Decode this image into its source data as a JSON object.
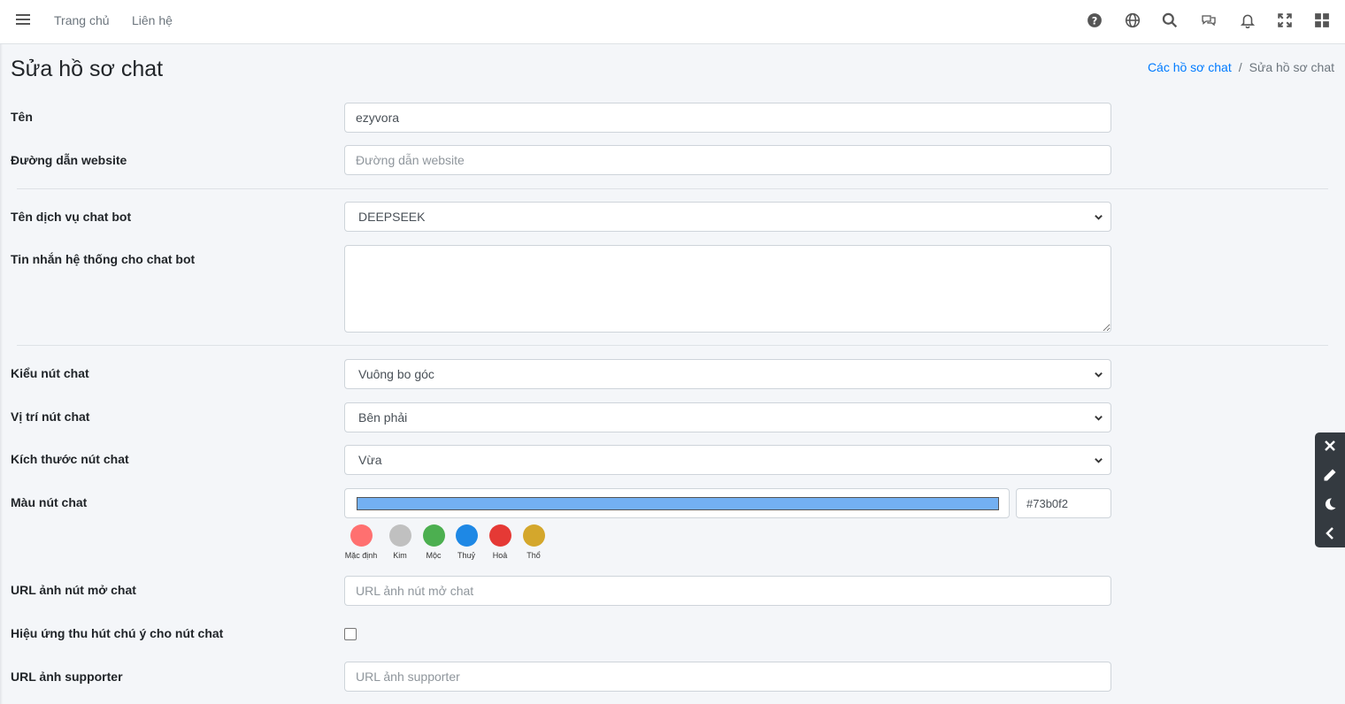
{
  "navbar": {
    "links": [
      "Trang chủ",
      "Liên hệ"
    ],
    "icons": [
      "help-icon",
      "globe-icon",
      "search-icon",
      "chat-icon",
      "bell-icon",
      "fullscreen-icon",
      "grid-icon"
    ]
  },
  "page": {
    "title": "Sửa hồ sơ chat",
    "breadcrumb": {
      "link": "Các hồ sơ chat",
      "separator": "/",
      "current": "Sửa hồ sơ chat"
    }
  },
  "form": {
    "name": {
      "label": "Tên",
      "value": "ezyvora"
    },
    "website": {
      "label": "Đường dẫn website",
      "placeholder": "Đường dẫn website",
      "value": ""
    },
    "chatbot_service": {
      "label": "Tên dịch vụ chat bot",
      "selected": "DEEPSEEK"
    },
    "system_message": {
      "label": "Tin nhắn hệ thống cho chat bot",
      "value": ""
    },
    "button_style": {
      "label": "Kiểu nút chat",
      "selected": "Vuông bo góc"
    },
    "button_position": {
      "label": "Vị trí nút chat",
      "selected": "Bên phải"
    },
    "button_size": {
      "label": "Kích thước nút chat",
      "selected": "Vừa"
    },
    "button_color": {
      "label": "Màu nút chat",
      "value": "#73b0f2",
      "bar_color": "#73b0f2",
      "presets": [
        {
          "label": "Mặc định",
          "color": "#ff7070"
        },
        {
          "label": "Kim",
          "color": "#c0c0c0"
        },
        {
          "label": "Mộc",
          "color": "#4caf50"
        },
        {
          "label": "Thuỷ",
          "color": "#1e88e5"
        },
        {
          "label": "Hoả",
          "color": "#e53935"
        },
        {
          "label": "Thổ",
          "color": "#d4a72c"
        }
      ]
    },
    "open_button_image": {
      "label": "URL ảnh nút mở chat",
      "placeholder": "URL ảnh nút mở chat",
      "value": ""
    },
    "attention_effect": {
      "label": "Hiệu ứng thu hút chú ý cho nút chat",
      "checked": false
    },
    "supporter_image": {
      "label": "URL ảnh supporter",
      "placeholder": "URL ảnh supporter",
      "value": ""
    }
  },
  "floating_toolbar": {
    "icons": [
      "close-icon",
      "pencil-icon",
      "moon-icon",
      "chevron-left-icon"
    ]
  },
  "colors": {
    "accent": "#007bff",
    "toolbar_bg": "#343a40"
  }
}
